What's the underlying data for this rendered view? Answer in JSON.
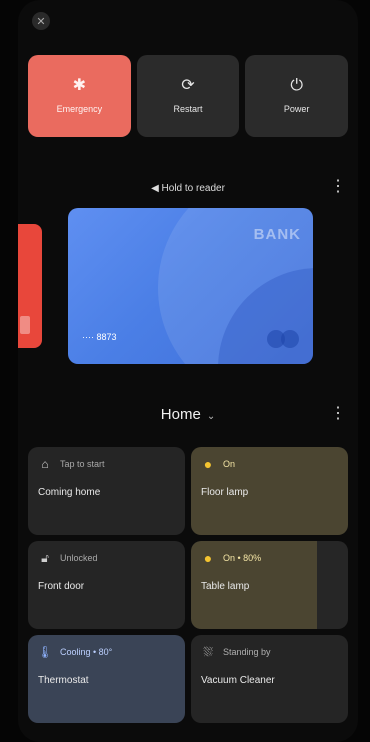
{
  "close_icon": "close-icon",
  "power_menu": {
    "emergency_label": "Emergency",
    "restart_label": "Restart",
    "power_label": "Power",
    "emergency_color": "#ea6b5f"
  },
  "wallet": {
    "hint": "Hold to reader",
    "card_brand": "BANK",
    "card_number": "···· 8873"
  },
  "home": {
    "title": "Home"
  },
  "tiles": [
    {
      "status": "Tap to start",
      "name": "Coming home"
    },
    {
      "status": "On",
      "name": "Floor lamp"
    },
    {
      "status": "Unlocked",
      "name": "Front door"
    },
    {
      "status": "On • 80%",
      "name": "Table lamp",
      "level": 0.8
    },
    {
      "status": "Cooling • 80°",
      "name": "Thermostat"
    },
    {
      "status": "Standing by",
      "name": "Vacuum Cleaner"
    }
  ]
}
